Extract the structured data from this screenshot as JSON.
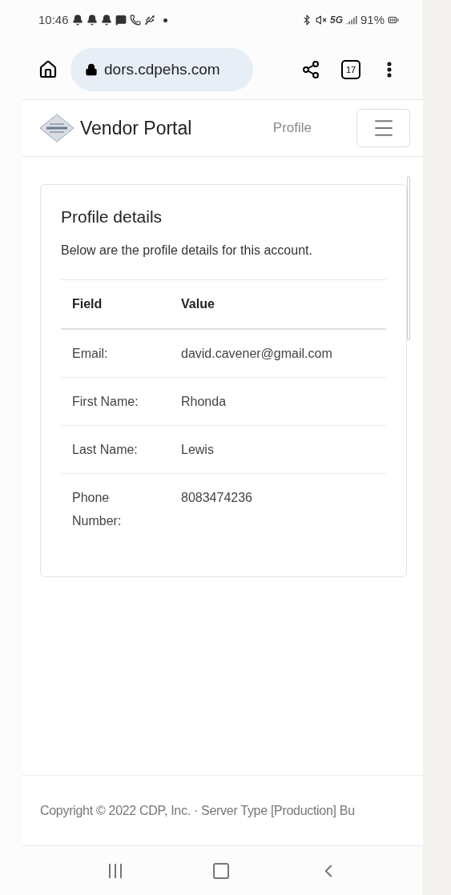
{
  "status_bar": {
    "time": "10:46",
    "battery": "91%",
    "network": "5G"
  },
  "browser": {
    "url": "dors.cdpehs.com",
    "tab_count": "17"
  },
  "navbar": {
    "brand": "Vendor Portal",
    "links": [
      {
        "label": "Profile",
        "selected": false
      }
    ]
  },
  "card": {
    "title": "Profile details",
    "description": "Below are the profile details for this account.",
    "table": {
      "columns": [
        "Field",
        "Value"
      ],
      "rows": [
        {
          "field": "Email:",
          "value": "david.cavener@gmail.com"
        },
        {
          "field": "First Name:",
          "value": "Rhonda"
        },
        {
          "field": "Last Name:",
          "value": "Lewis"
        },
        {
          "field": "Phone Number:",
          "value": "8083474236"
        }
      ]
    }
  },
  "footer": {
    "text": "Copyright © 2022 CDP, Inc. · Server Type [Production] Bu"
  }
}
